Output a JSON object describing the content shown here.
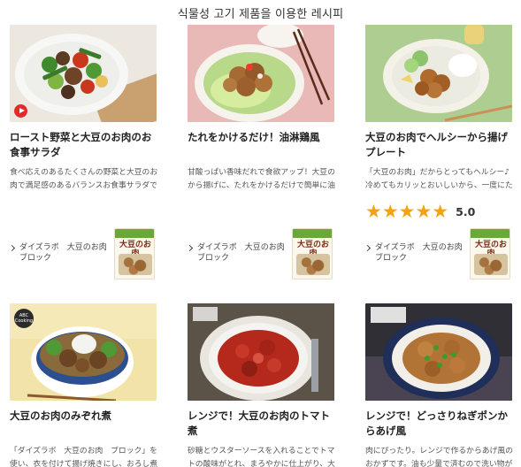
{
  "header": {
    "title": "식물성 고기 제품을 이용한 레시피"
  },
  "recipes": [
    {
      "title": "ロースト野菜と大豆のお肉のお食事サラダ",
      "description": "食べ応えのあるたくさんの野菜と大豆のお肉で満足感のあるバランスお食事サラダです",
      "product_link": [
        "ダイズラボ　大豆のお肉",
        "ブロック"
      ],
      "product_name": "大豆のお肉",
      "has_video": true
    },
    {
      "title": "たれをかけるだけ！油淋鶏風",
      "description": "甘酸っぱい香味だれで食欲アップ！大豆のから揚げに、たれをかけるだけで簡単に油淋...",
      "product_link": [
        "ダイズラボ　大豆のお肉",
        "ブロック"
      ],
      "product_name": "大豆のお肉"
    },
    {
      "title": "大豆のお肉でヘルシーから揚げプレート",
      "description": "「大豆のお肉」だからとってもヘルシー♪冷めてもカリッとおいしいから、一度にたくさ...",
      "rating": {
        "stars": "★★★★★",
        "score": "5.0"
      },
      "product_link": [
        "ダイズラボ　大豆のお肉",
        "ブロック"
      ],
      "product_name": "大豆のお肉"
    },
    {
      "title": "大豆のお肉のみぞれ煮",
      "description": "「ダイズラボ　大豆のお肉　ブロック」を使い、衣を付けて揚げ焼きにし、おろし煮を作...",
      "badge": "ABC Cooking"
    },
    {
      "title": "レンジで！大豆のお肉のトマト煮",
      "description": "砂糖とウスターソースを入れることでトマトの酸味がとれ、まろやかに仕上がり、大豆..."
    },
    {
      "title": "レンジで！どっさりねぎポンからあげ風",
      "description": "肉にぴったり。レンジで作るからあげ風のおかずです。油も少量で済むので洗い物がラ..."
    }
  ]
}
